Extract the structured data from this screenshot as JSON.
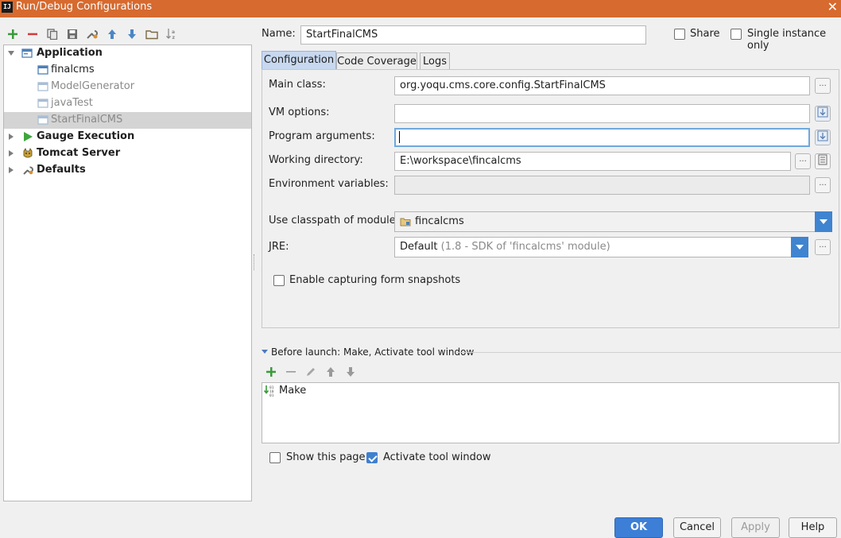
{
  "window": {
    "title": "Run/Debug Configurations",
    "app_icon_text": "IJ",
    "close_glyph": "✕"
  },
  "toolbar_icons": [
    "add-icon",
    "remove-icon",
    "copy-icon",
    "save-icon",
    "wrench-icon",
    "move-up-icon",
    "move-down-icon",
    "folder-icon",
    "sort-icon"
  ],
  "tree": {
    "items": [
      {
        "label": "Application",
        "bold": true,
        "expanded": true,
        "icon": "application-icon"
      },
      {
        "label": "finalcms",
        "icon": "app-config-icon"
      },
      {
        "label": "ModelGenerator",
        "dim": true,
        "icon": "app-config-icon"
      },
      {
        "label": "javaTest",
        "dim": true,
        "icon": "app-config-icon"
      },
      {
        "label": "StartFinalCMS",
        "dim": true,
        "selected": true,
        "icon": "app-config-icon"
      },
      {
        "label": "Gauge Execution",
        "bold": true,
        "icon": "gauge-run-icon"
      },
      {
        "label": "Tomcat Server",
        "bold": true,
        "icon": "tomcat-icon"
      },
      {
        "label": "Defaults",
        "bold": true,
        "icon": "defaults-wrench-icon"
      }
    ]
  },
  "header": {
    "name_label": "Name:",
    "name_value": "StartFinalCMS",
    "share_label": "Share",
    "single_instance_label": "Single instance only"
  },
  "tabs": [
    {
      "label": "Configuration",
      "active": true
    },
    {
      "label": "Code Coverage"
    },
    {
      "label": "Logs"
    }
  ],
  "config": {
    "main_class_label": "Main class:",
    "main_class_value": "org.yoqu.cms.core.config.StartFinalCMS",
    "vm_options_label": "VM options:",
    "vm_options_value": "",
    "program_args_label": "Program arguments:",
    "program_args_value": "",
    "working_dir_label": "Working directory:",
    "working_dir_value": "E:\\workspace\\fincalcms",
    "env_vars_label": "Environment variables:",
    "env_vars_value": "",
    "classpath_label": "Use classpath of module:",
    "classpath_value": "fincalcms",
    "jre_label": "JRE:",
    "jre_value": "Default",
    "jre_detail": "(1.8 - SDK of 'fincalcms' module)",
    "snapshots_label": "Enable capturing form snapshots",
    "ellipsis": "..."
  },
  "before_launch": {
    "title": "Before launch: Make, Activate tool window",
    "items": [
      {
        "label": "Make",
        "icon": "make-binary-icon"
      }
    ],
    "show_page_label": "Show this page",
    "activate_tool_label": "Activate tool window",
    "activate_tool_checked": true
  },
  "buttons": {
    "ok": "OK",
    "cancel": "Cancel",
    "apply": "Apply",
    "help": "Help"
  },
  "colors": {
    "titlebar": "#d66a2f",
    "accent_blue": "#3d7fd6",
    "add_green": "#3a9a3a",
    "remove_red": "#d33a3a"
  }
}
